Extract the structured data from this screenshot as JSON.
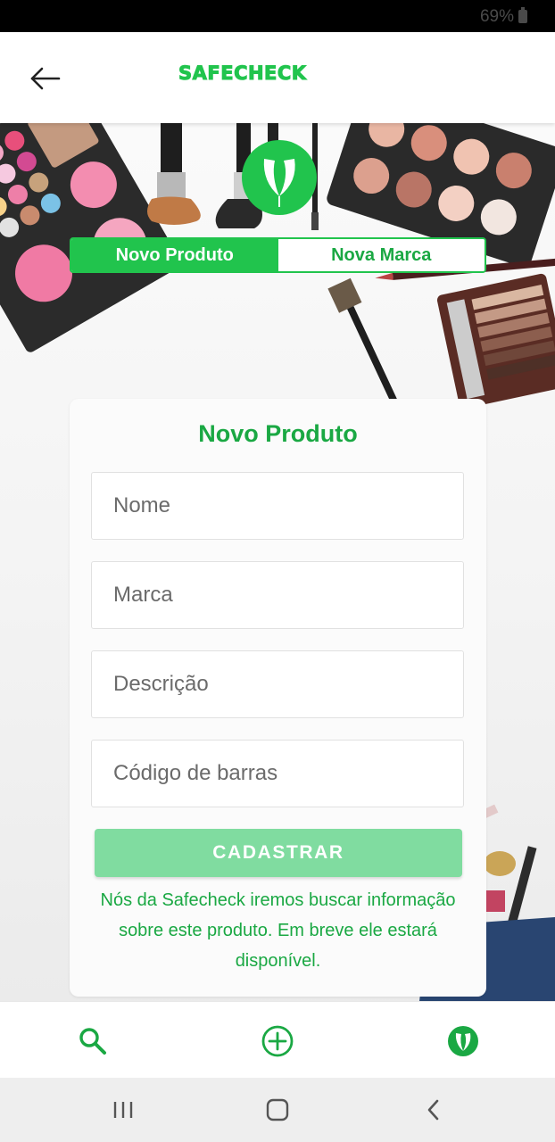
{
  "status_bar": {
    "battery": "69%"
  },
  "header": {
    "logo_text": "SAFECHECK",
    "back_icon": "arrow-left-icon"
  },
  "tabs": [
    {
      "label": "Novo Produto",
      "active": true
    },
    {
      "label": "Nova Marca",
      "active": false
    }
  ],
  "form": {
    "title": "Novo Produto",
    "fields": {
      "name_placeholder": "Nome",
      "brand_placeholder": "Marca",
      "description_placeholder": "Descrição",
      "barcode_placeholder": "Código de barras"
    },
    "submit_label": "CADASTRAR",
    "info_text": "Nós da Safecheck iremos buscar informação sobre este produto. Em breve ele estará disponível."
  },
  "bottom_nav": {
    "items": [
      {
        "icon": "search-icon"
      },
      {
        "icon": "add-circle-icon"
      },
      {
        "icon": "leaf-logo-icon"
      }
    ]
  },
  "colors": {
    "brand_green": "#21c44d",
    "text_green": "#1aa843",
    "button_disabled_green": "#80dca0"
  }
}
